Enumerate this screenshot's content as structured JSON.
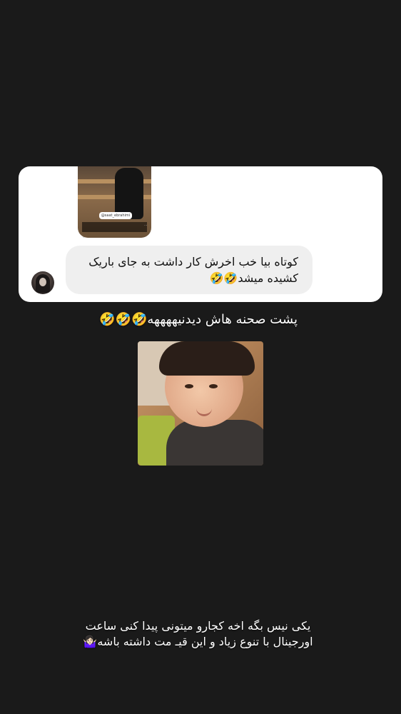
{
  "reply_card": {
    "story_thumbnail": {
      "username_tag": "@saat_ebrahimi",
      "caption": "..."
    },
    "message": {
      "line1": "کوتاه بیا خب اخرش کار داشت به جای باریک",
      "line2": "کشیده میشد🤣🤣"
    }
  },
  "story": {
    "headline": "پشت صحنه هاش دیدنیههههه🤣🤣🤣",
    "footer_line1": "یکی نیس بگه اخه کجارو میتونی پیدا کنی ساعت",
    "footer_line2": "اورجینال با تنوع زیاد و این قیـ مت داشته باشه🤷🏻‍♀️"
  }
}
